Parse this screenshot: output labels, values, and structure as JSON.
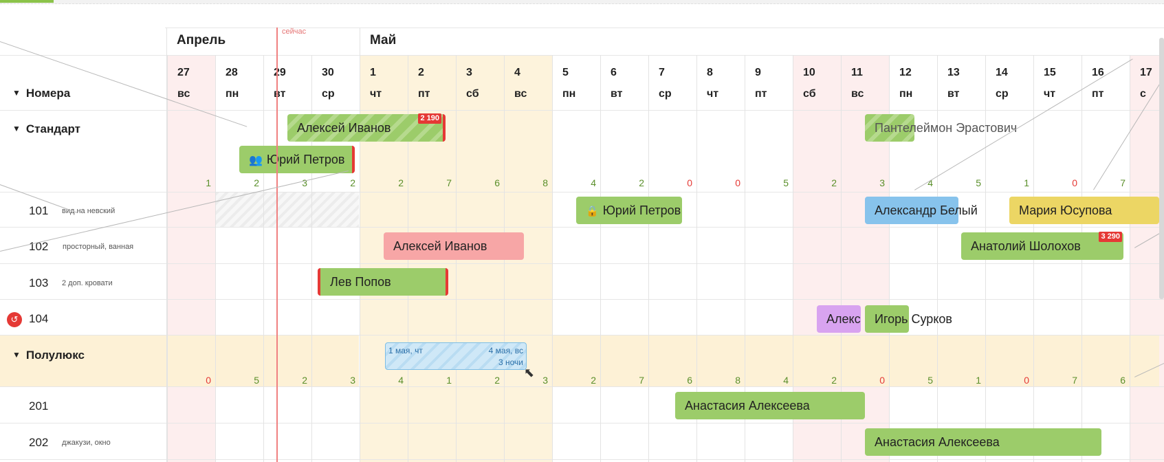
{
  "header": {
    "rooms_label": "Номера",
    "now_label": "сейчас",
    "months": [
      "Апрель",
      "Май"
    ]
  },
  "days": [
    {
      "num": "27",
      "wd": "вс"
    },
    {
      "num": "28",
      "wd": "пн"
    },
    {
      "num": "29",
      "wd": "вт"
    },
    {
      "num": "30",
      "wd": "ср"
    },
    {
      "num": "1",
      "wd": "чт"
    },
    {
      "num": "2",
      "wd": "пт"
    },
    {
      "num": "3",
      "wd": "сб"
    },
    {
      "num": "4",
      "wd": "вс"
    },
    {
      "num": "5",
      "wd": "пн"
    },
    {
      "num": "6",
      "wd": "вт"
    },
    {
      "num": "7",
      "wd": "ср"
    },
    {
      "num": "8",
      "wd": "чт"
    },
    {
      "num": "9",
      "wd": "пт"
    },
    {
      "num": "10",
      "wd": "сб"
    },
    {
      "num": "11",
      "wd": "вс"
    },
    {
      "num": "12",
      "wd": "пн"
    },
    {
      "num": "13",
      "wd": "вт"
    },
    {
      "num": "14",
      "wd": "ср"
    },
    {
      "num": "15",
      "wd": "чт"
    },
    {
      "num": "16",
      "wd": "пт"
    },
    {
      "num": "17",
      "wd": "с"
    }
  ],
  "groups": [
    {
      "name": "Стандарт",
      "counts": [
        "1",
        "2",
        "3",
        "2",
        "2",
        "7",
        "6",
        "8",
        "4",
        "2",
        "0",
        "0",
        "5",
        "2",
        "3",
        "4",
        "5",
        "1",
        "0",
        "7"
      ],
      "rooms": [
        {
          "number": "101",
          "desc": "вид на невский"
        },
        {
          "number": "102",
          "desc": "просторный, ванная"
        },
        {
          "number": "103",
          "desc": "2 доп. кровати"
        },
        {
          "number": "104",
          "desc": ""
        }
      ]
    },
    {
      "name": "Полулюкс",
      "counts": [
        "0",
        "5",
        "2",
        "3",
        "4",
        "1",
        "2",
        "3",
        "2",
        "7",
        "6",
        "8",
        "4",
        "2",
        "0",
        "5",
        "1",
        "0",
        "7",
        "6"
      ],
      "rooms": [
        {
          "number": "201",
          "desc": ""
        },
        {
          "number": "202",
          "desc": "джакузи, окно"
        }
      ]
    }
  ],
  "bookings": {
    "b1": {
      "guest": "Алексей Иванов",
      "price": "2 190"
    },
    "b2": {
      "guest": "Пантелеймон Эрастович"
    },
    "b3": {
      "guest": "Юрий Петров"
    },
    "b4": {
      "guest": "Юрий Петров"
    },
    "b5": {
      "guest": "Александр Белый"
    },
    "b6": {
      "guest": "Мария Юсупова"
    },
    "b7": {
      "guest": "Алексей Иванов"
    },
    "b8": {
      "guest": "Анатолий Шолохов",
      "price": "3 290"
    },
    "b9": {
      "guest": "Лев Попов"
    },
    "b10": {
      "guest": "Алекс"
    },
    "b11": {
      "guest": "Игорь Сурков"
    },
    "b12": {
      "guest": "Анастасия Алексеева"
    },
    "b13": {
      "guest": "Анастасия Алексеева"
    }
  },
  "selection": {
    "start": "1 мая, чт",
    "end": "4 мая, вс",
    "nights": "3 ночи"
  },
  "colors": {
    "green": "#9ccc6a",
    "pink": "#f7a6a6",
    "blue": "#87c3ec",
    "yellow": "#ecd664",
    "purple": "#d8a3f0",
    "accent_red": "#e53935",
    "weekend_bg": "#fdeeee",
    "holiday_bg": "#fdf3dc"
  },
  "icons": [
    "group-icon",
    "lock-icon",
    "dirty-room-icon",
    "collapse-triangle-icon",
    "cursor-icon"
  ]
}
